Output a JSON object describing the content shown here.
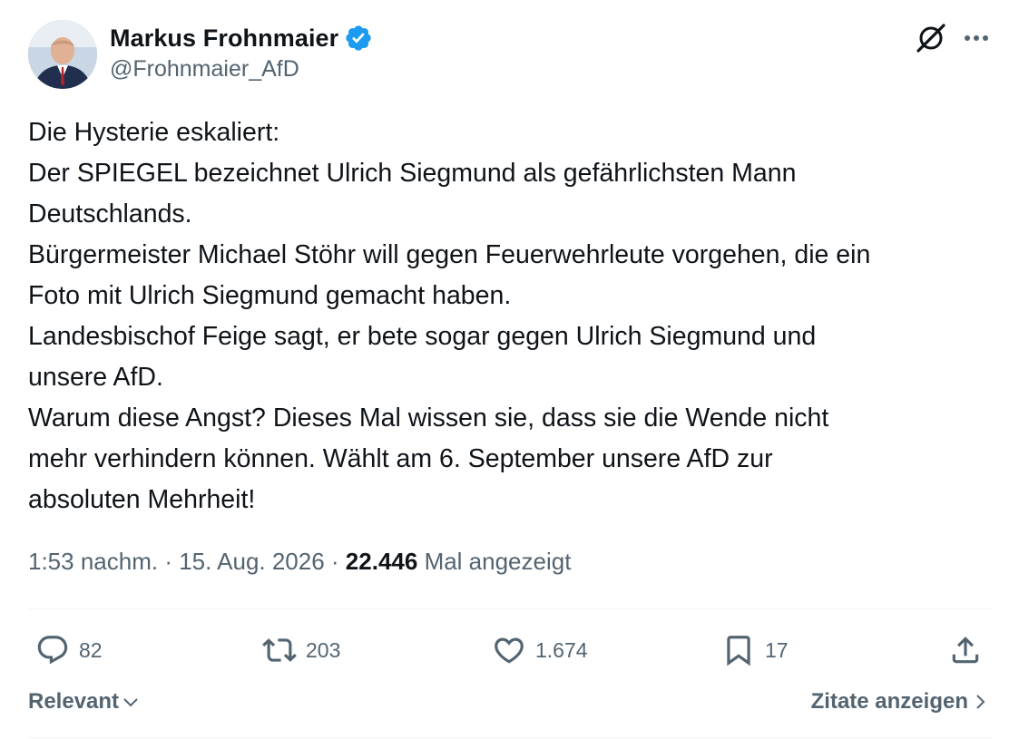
{
  "author": {
    "name": "Markus Frohnmaier",
    "handle": "@Frohnmaier_AfD"
  },
  "tweet": {
    "lines": [
      "Die Hysterie eskaliert:",
      "Der SPIEGEL bezeichnet Ulrich Siegmund als gefährlichsten Mann",
      "Deutschlands.",
      "Bürgermeister Michael Stöhr will gegen Feuerwehrleute vorgehen, die ein",
      "Foto mit Ulrich Siegmund gemacht haben.",
      "Landesbischof Feige sagt, er bete sogar gegen Ulrich Siegmund und",
      "unsere AfD.",
      "Warum diese Angst? Dieses Mal wissen sie, dass sie die Wende nicht",
      "mehr verhindern können. Wählt am 6. September unsere AfD zur",
      "absoluten Mehrheit!"
    ]
  },
  "meta": {
    "time": "1:53 nachm.",
    "sep": " · ",
    "date": "15. Aug. 2026",
    "views_count": "22.446",
    "views_label": "Mal angezeigt"
  },
  "actions": {
    "replies": "82",
    "reposts": "203",
    "likes": "1.674",
    "bookmarks": "17"
  },
  "footer": {
    "sort_label": "Relevant",
    "quotes_label": "Zitate anzeigen"
  },
  "colors": {
    "text": "#0f1419",
    "secondary": "#536471",
    "verified": "#1d9bf0",
    "divider": "#eff3f4"
  },
  "icons": [
    "verified-badge-icon",
    "grok-icon",
    "more-icon",
    "reply-icon",
    "repost-icon",
    "like-icon",
    "bookmark-icon",
    "share-icon",
    "chevron-down-icon",
    "chevron-right-icon"
  ]
}
